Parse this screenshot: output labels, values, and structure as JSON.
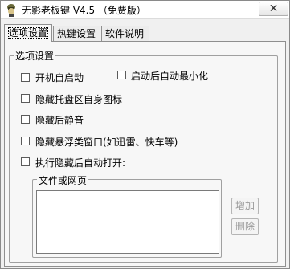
{
  "window": {
    "title": "无影老板键 V4.5 （免费版）",
    "close_label": "✕"
  },
  "tabs": [
    {
      "label": "选项设置",
      "active": true
    },
    {
      "label": "热键设置",
      "active": false
    },
    {
      "label": "软件说明",
      "active": false
    }
  ],
  "options": {
    "group_title": "选项设置",
    "startup": "开机自启动",
    "minimize_after_start": "启动后自动最小化",
    "hide_tray_icon": "隐藏托盘区自身图标",
    "mute_after_hide": "隐藏后静音",
    "hide_floating_windows": "隐藏悬浮类窗口(如迅雷、快车等)",
    "run_after_hide": "执行隐藏后自动打开:",
    "files_group_title": "文件或网页",
    "textarea_value": "",
    "add_button": "增加",
    "delete_button": "删除"
  }
}
